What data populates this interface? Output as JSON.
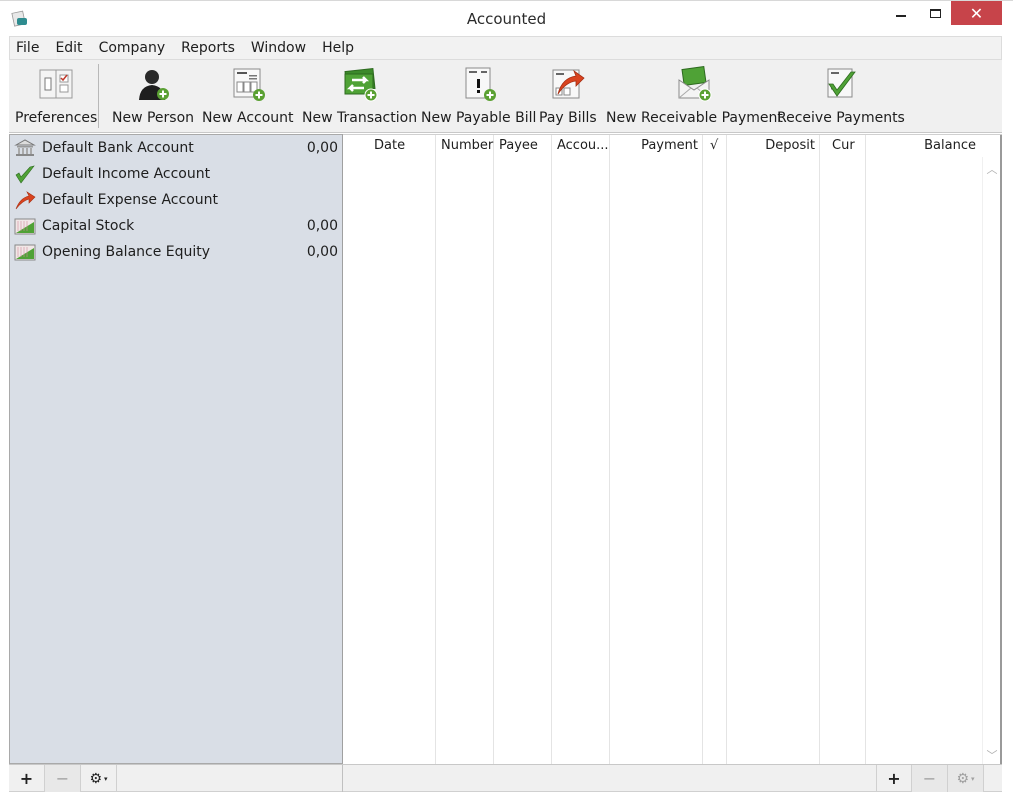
{
  "window": {
    "title": "Accounted",
    "minimize_glyph": "—",
    "maximize_glyph": "☐",
    "close_glyph": "✕"
  },
  "menu": [
    "File",
    "Edit",
    "Company",
    "Reports",
    "Window",
    "Help"
  ],
  "toolbar": {
    "items": [
      {
        "label": "Preferences",
        "icon": "preferences-icon"
      },
      {
        "label": "New Person",
        "icon": "new-person-icon"
      },
      {
        "label": "New Account",
        "icon": "new-account-icon"
      },
      {
        "label": "New Transaction",
        "icon": "new-transaction-icon"
      },
      {
        "label": "New Payable Bill",
        "icon": "new-payable-bill-icon"
      },
      {
        "label": "Pay Bills",
        "icon": "pay-bills-icon"
      },
      {
        "label": "New Receivable Payment",
        "icon": "new-receivable-payment-icon"
      },
      {
        "label": "Receive Payments",
        "icon": "receive-payments-icon"
      }
    ]
  },
  "accounts": [
    {
      "name": "Default Bank Account",
      "balance": "0,00",
      "icon": "bank-icon"
    },
    {
      "name": "Default Income Account",
      "balance": "",
      "icon": "income-checkmark-icon"
    },
    {
      "name": "Default Expense Account",
      "balance": "",
      "icon": "expense-arrow-icon"
    },
    {
      "name": "Capital Stock",
      "balance": "0,00",
      "icon": "equity-chart-icon"
    },
    {
      "name": "Opening Balance Equity",
      "balance": "0,00",
      "icon": "equity-chart-icon"
    }
  ],
  "register": {
    "columns": [
      "Date",
      "Number",
      "Payee",
      "Accou...",
      "Payment",
      "√",
      "Deposit",
      "Cur",
      "Balance"
    ],
    "rows": []
  },
  "bottom": {
    "add_glyph": "+",
    "remove_glyph": "−",
    "gear_glyph": "⚙",
    "caret_glyph": "▾"
  }
}
